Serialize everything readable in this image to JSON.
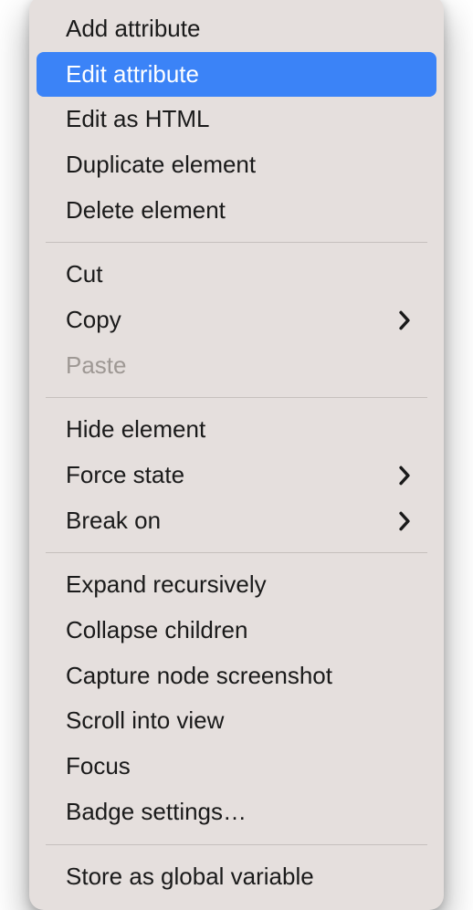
{
  "menu": {
    "groups": [
      [
        {
          "id": "add-attribute",
          "label": "Add attribute",
          "submenu": false,
          "disabled": false,
          "highlighted": false
        },
        {
          "id": "edit-attribute",
          "label": "Edit attribute",
          "submenu": false,
          "disabled": false,
          "highlighted": true
        },
        {
          "id": "edit-as-html",
          "label": "Edit as HTML",
          "submenu": false,
          "disabled": false,
          "highlighted": false
        },
        {
          "id": "duplicate-element",
          "label": "Duplicate element",
          "submenu": false,
          "disabled": false,
          "highlighted": false
        },
        {
          "id": "delete-element",
          "label": "Delete element",
          "submenu": false,
          "disabled": false,
          "highlighted": false
        }
      ],
      [
        {
          "id": "cut",
          "label": "Cut",
          "submenu": false,
          "disabled": false,
          "highlighted": false
        },
        {
          "id": "copy",
          "label": "Copy",
          "submenu": true,
          "disabled": false,
          "highlighted": false
        },
        {
          "id": "paste",
          "label": "Paste",
          "submenu": false,
          "disabled": true,
          "highlighted": false
        }
      ],
      [
        {
          "id": "hide-element",
          "label": "Hide element",
          "submenu": false,
          "disabled": false,
          "highlighted": false
        },
        {
          "id": "force-state",
          "label": "Force state",
          "submenu": true,
          "disabled": false,
          "highlighted": false
        },
        {
          "id": "break-on",
          "label": "Break on",
          "submenu": true,
          "disabled": false,
          "highlighted": false
        }
      ],
      [
        {
          "id": "expand-recursively",
          "label": "Expand recursively",
          "submenu": false,
          "disabled": false,
          "highlighted": false
        },
        {
          "id": "collapse-children",
          "label": "Collapse children",
          "submenu": false,
          "disabled": false,
          "highlighted": false
        },
        {
          "id": "capture-node-screenshot",
          "label": "Capture node screenshot",
          "submenu": false,
          "disabled": false,
          "highlighted": false
        },
        {
          "id": "scroll-into-view",
          "label": "Scroll into view",
          "submenu": false,
          "disabled": false,
          "highlighted": false
        },
        {
          "id": "focus",
          "label": "Focus",
          "submenu": false,
          "disabled": false,
          "highlighted": false
        },
        {
          "id": "badge-settings",
          "label": "Badge settings…",
          "submenu": false,
          "disabled": false,
          "highlighted": false
        }
      ],
      [
        {
          "id": "store-as-global-variable",
          "label": "Store as global variable",
          "submenu": false,
          "disabled": false,
          "highlighted": false
        }
      ]
    ]
  }
}
